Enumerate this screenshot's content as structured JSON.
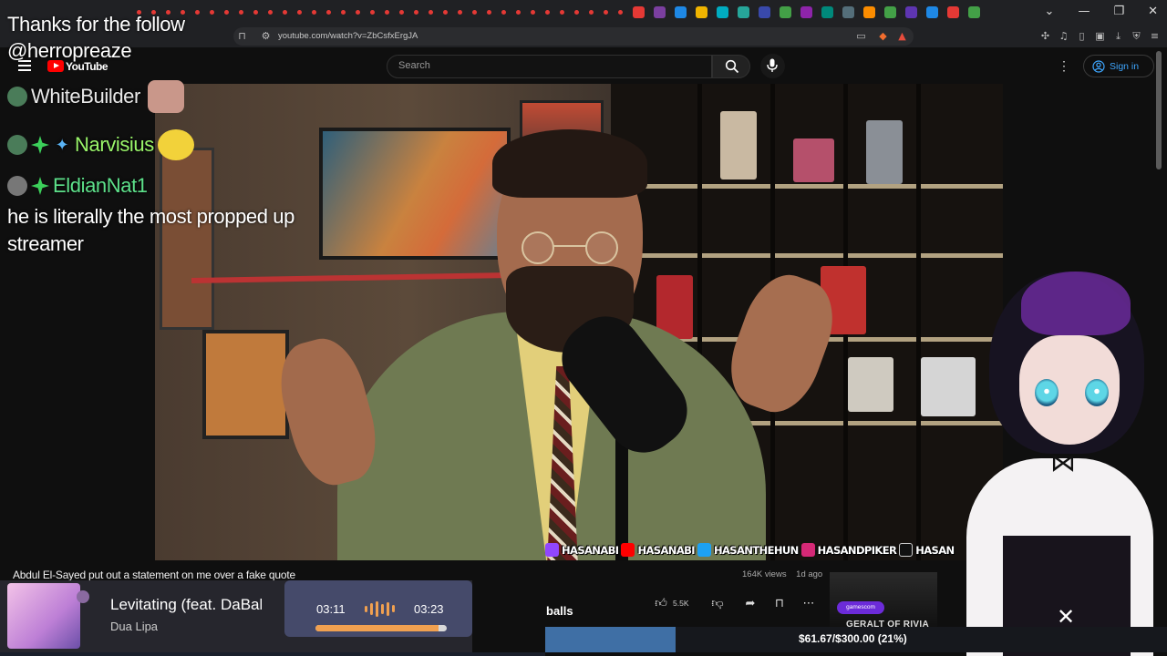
{
  "browser": {
    "url": "youtube.com/watch?v=ZbCsfxErgJA",
    "window_controls": [
      "⌄",
      "—",
      "❐",
      "✕"
    ]
  },
  "youtube": {
    "wordmark": "YouTube",
    "search_placeholder": "Search",
    "sign_in": "Sign in"
  },
  "overlay": {
    "follow_alert": "Thanks for the follow @herropreaze",
    "chat": [
      {
        "user": "WhiteBuilder",
        "color": "#e8e8e8"
      },
      {
        "user": "Narvisius",
        "color": "#9af56a"
      },
      {
        "user": "EldianNat1",
        "color": "#5de08a"
      }
    ],
    "message": "he is literally the most propped up streamer"
  },
  "socials": [
    "HASANABI",
    "HASANABI",
    "HASANTHEHUN",
    "HASANDPIKER",
    "HASAN"
  ],
  "video": {
    "title": "Abdul El-Sayed put out a statement on me over a fake quote",
    "views": "164K views",
    "age": "1d ago",
    "likes": "5.5K"
  },
  "now_playing": {
    "title": "Levitating (feat. DaBaby)",
    "artist": "Dua Lipa",
    "current": "03:11",
    "total": "03:23",
    "progress": 0.94
  },
  "comment_word": "balls",
  "goal": {
    "text": "$61.67/$300.00 (21%)",
    "progress": 0.21
  },
  "promo": {
    "badge": "gamescom",
    "label": "GERALT OF RIVIA"
  },
  "colors": {
    "youtube_red": "#ff0000",
    "signin_blue": "#3ea6ff",
    "song_accent": "#f0a050",
    "goal_fill": "#3f6fa5"
  },
  "icons": [
    "hamburger-icon",
    "youtube-logo-icon",
    "search-icon",
    "mic-icon",
    "more-vert-icon",
    "account-icon",
    "like-icon",
    "dislike-icon",
    "share-icon",
    "save-icon",
    "more-horiz-icon",
    "close-icon"
  ]
}
